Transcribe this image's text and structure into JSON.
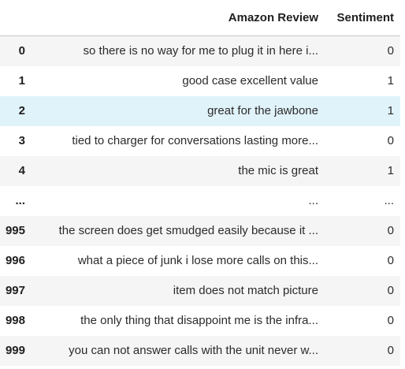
{
  "table": {
    "index_header": "",
    "columns": [
      "Amazon Review",
      "Sentiment"
    ],
    "rows": [
      {
        "index": "0",
        "review": "so there is no way for me to plug it in here i...",
        "sentiment": "0"
      },
      {
        "index": "1",
        "review": "good case excellent value",
        "sentiment": "1"
      },
      {
        "index": "2",
        "review": "great for the jawbone",
        "sentiment": "1"
      },
      {
        "index": "3",
        "review": "tied to charger for conversations lasting more...",
        "sentiment": "0"
      },
      {
        "index": "4",
        "review": "the mic is great",
        "sentiment": "1"
      },
      {
        "index": "...",
        "review": "...",
        "sentiment": "..."
      },
      {
        "index": "995",
        "review": "the screen does get smudged easily because it ...",
        "sentiment": "0"
      },
      {
        "index": "996",
        "review": "what a piece of junk i lose more calls on this...",
        "sentiment": "0"
      },
      {
        "index": "997",
        "review": "item does not match picture",
        "sentiment": "0"
      },
      {
        "index": "998",
        "review": "the only thing that disappoint me is the infra...",
        "sentiment": "0"
      },
      {
        "index": "999",
        "review": "you can not answer calls with the unit never w...",
        "sentiment": "0"
      }
    ],
    "hovered_row": 2
  },
  "colors": {
    "stripe": "#f5f5f5",
    "hover": "#e1f3fa",
    "header_border": "#c8c8c8"
  }
}
